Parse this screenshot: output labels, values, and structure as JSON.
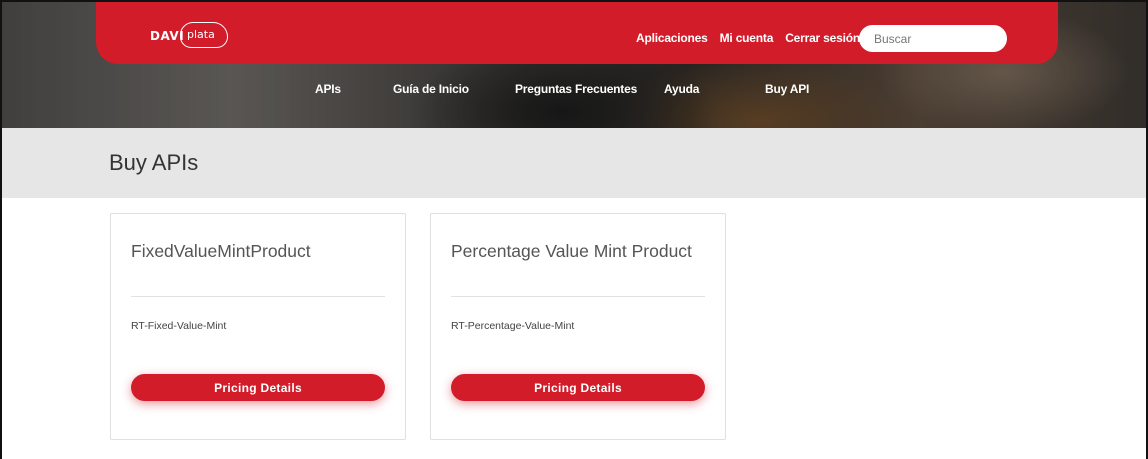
{
  "brand": {
    "logo_text_left": "DAVI",
    "logo_text_right": "plata"
  },
  "topbar": {
    "links": [
      "Aplicaciones",
      "Mi cuenta",
      "Cerrar sesión"
    ],
    "search_placeholder": "Buscar"
  },
  "nav": {
    "items": [
      "APIs",
      "Guía de Inicio",
      "Preguntas Frecuentes",
      "Ayuda",
      "Buy API"
    ]
  },
  "page": {
    "title": "Buy APIs"
  },
  "products": [
    {
      "name": "FixedValueMintProduct",
      "code": "RT-Fixed-Value-Mint",
      "button": "Pricing Details"
    },
    {
      "name": "Percentage Value Mint Product",
      "code": "RT-Percentage-Value-Mint",
      "button": "Pricing Details"
    }
  ],
  "colors": {
    "brand_red": "#d21c2a",
    "title_band": "#e6e6e6"
  }
}
